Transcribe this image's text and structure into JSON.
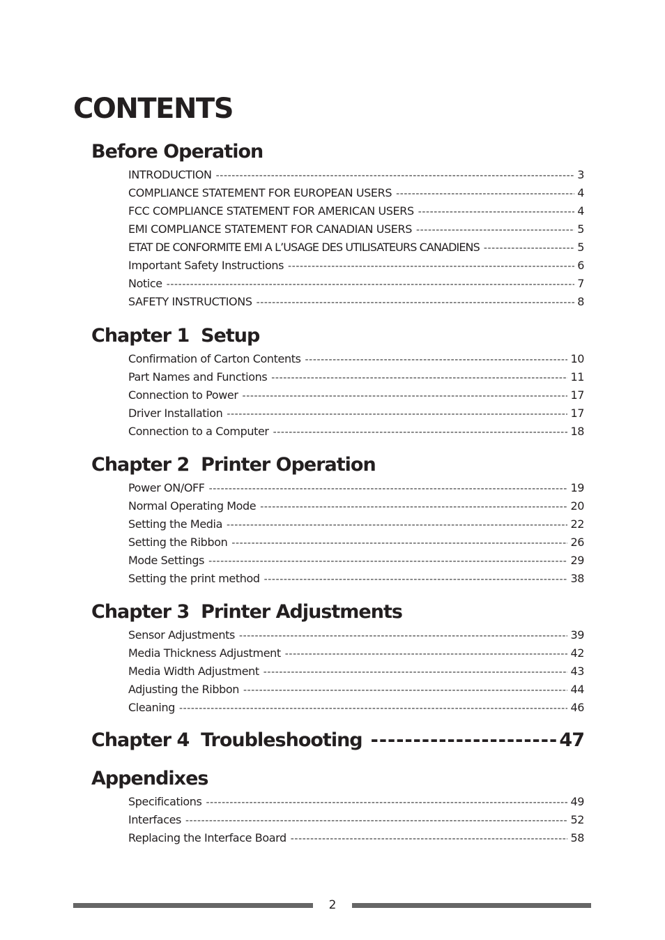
{
  "title": "CONTENTS",
  "sections": [
    {
      "heading": "Before Operation",
      "entries": [
        {
          "text": "INTRODUCTION",
          "page": "3"
        },
        {
          "text": "COMPLIANCE STATEMENT FOR EUROPEAN USERS",
          "page": "4"
        },
        {
          "text": "FCC COMPLIANCE STATEMENT FOR AMERICAN USERS",
          "page": "4"
        },
        {
          "text": "EMI COMPLIANCE STATEMENT FOR CANADIAN USERS",
          "page": "5"
        },
        {
          "text": "ETAT DE CONFORMITE EMI A L’USAGE DES UTILISATEURS CANADIENS",
          "page": "5"
        },
        {
          "text": "Important Safety Instructions",
          "page": "6"
        },
        {
          "text": "Notice",
          "page": "7"
        },
        {
          "text": "SAFETY INSTRUCTIONS",
          "page": "8"
        }
      ]
    },
    {
      "heading": "Chapter 1  Setup",
      "entries": [
        {
          "text": "Confirmation of Carton Contents",
          "page": "10"
        },
        {
          "text": "Part Names and Functions",
          "page": "11"
        },
        {
          "text": "Connection to Power",
          "page": "17"
        },
        {
          "text": "Driver Installation",
          "page": "17"
        },
        {
          "text": "Connection to a Computer",
          "page": "18"
        }
      ]
    },
    {
      "heading": "Chapter 2  Printer Operation",
      "entries": [
        {
          "text": "Power ON/OFF",
          "page": "19"
        },
        {
          "text": "Normal Operating Mode",
          "page": "20"
        },
        {
          "text": "Setting the Media",
          "page": "22"
        },
        {
          "text": "Setting the Ribbon",
          "page": "26"
        },
        {
          "text": "Mode Settings",
          "page": "29"
        },
        {
          "text": "Setting the print method",
          "page": "38"
        }
      ]
    },
    {
      "heading": "Chapter 3  Printer Adjustments",
      "entries": [
        {
          "text": "Sensor Adjustments",
          "page": "39"
        },
        {
          "text": "Media Thickness Adjustment",
          "page": "42"
        },
        {
          "text": "Media Width Adjustment",
          "page": "43"
        },
        {
          "text": "Adjusting the Ribbon",
          "page": "44"
        },
        {
          "text": "Cleaning",
          "page": "46"
        }
      ]
    },
    {
      "heading": "Chapter 4  Troubleshooting",
      "page": "47",
      "entries": []
    },
    {
      "heading": "Appendixes",
      "entries": [
        {
          "text": "Specifications",
          "page": "49"
        },
        {
          "text": "Interfaces",
          "page": "52"
        },
        {
          "text": "Replacing the Interface Board",
          "page": "58"
        }
      ]
    }
  ],
  "leader_char": "-",
  "footer": {
    "page_number": "2"
  }
}
